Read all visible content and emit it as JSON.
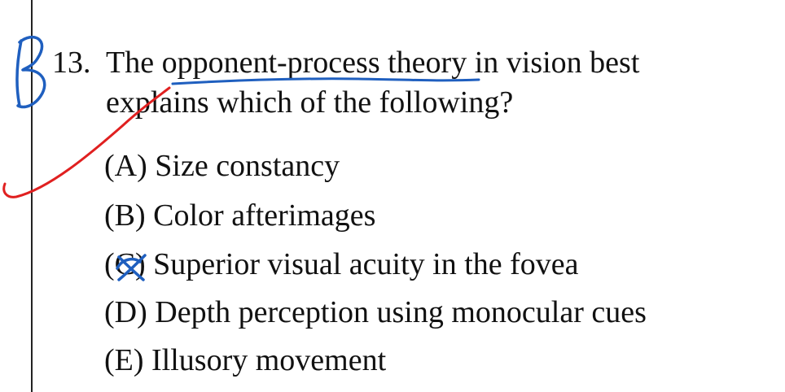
{
  "question": {
    "number": "13.",
    "text_line1": "The opponent-process theory in vision best",
    "text_line2": "explains which of the following?"
  },
  "options": [
    {
      "letter": "(A)",
      "text": "Size constancy"
    },
    {
      "letter": "(B)",
      "text": "Color afterimages"
    },
    {
      "letter": "(C)",
      "text": "Superior visual acuity in the fovea"
    },
    {
      "letter": "(D)",
      "text": "Depth perception using monocular cues"
    },
    {
      "letter": "(E)",
      "text": "Illusory movement"
    }
  ],
  "annotations": {
    "handwritten_answer": "B",
    "blue_ink": "#1f5fbf",
    "red_ink": "#e02020"
  }
}
